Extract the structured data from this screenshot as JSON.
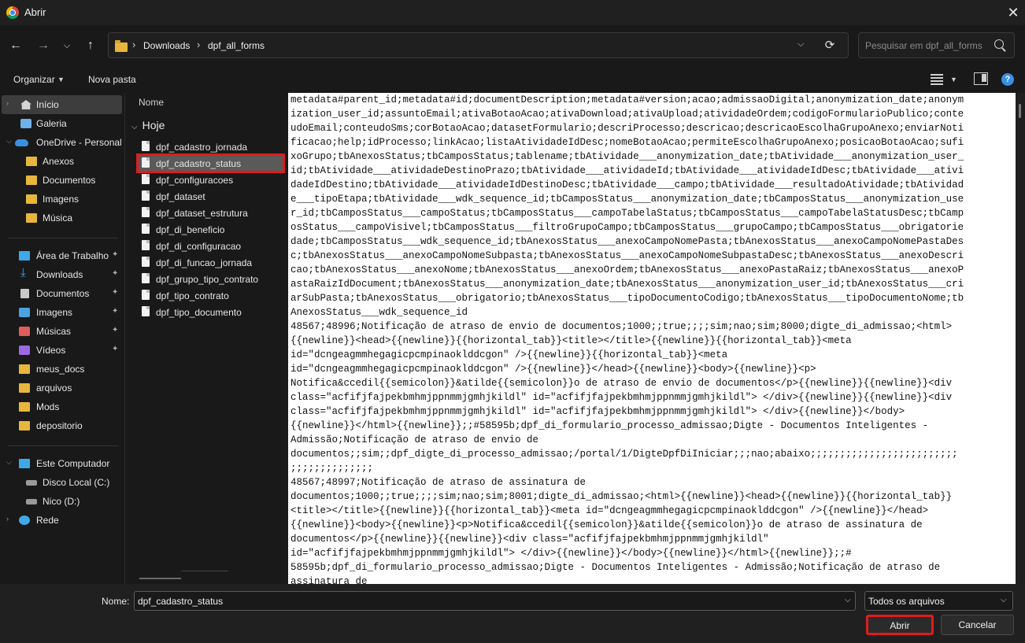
{
  "window": {
    "title": "Abrir"
  },
  "nav": {
    "breadcrumb": [
      "Downloads",
      "dpf_all_forms"
    ],
    "search_placeholder": "Pesquisar em dpf_all_forms"
  },
  "toolbar": {
    "organize": "Organizar",
    "new_folder": "Nova pasta"
  },
  "sidebar": {
    "items": [
      {
        "label": "Início",
        "icon": "home-icon"
      },
      {
        "label": "Galeria",
        "icon": "gallery-icon"
      },
      {
        "label": "OneDrive - Personal",
        "icon": "cloud-icon"
      },
      {
        "label": "Anexos",
        "icon": "folder-icon"
      },
      {
        "label": "Documentos",
        "icon": "folder-icon"
      },
      {
        "label": "Imagens",
        "icon": "folder-icon"
      },
      {
        "label": "Música",
        "icon": "folder-icon"
      },
      {
        "label": "Área de Trabalho",
        "icon": "desktop-icon"
      },
      {
        "label": "Downloads",
        "icon": "download-icon"
      },
      {
        "label": "Documentos",
        "icon": "documents-icon"
      },
      {
        "label": "Imagens",
        "icon": "pictures-icon"
      },
      {
        "label": "Músicas",
        "icon": "music-icon"
      },
      {
        "label": "Vídeos",
        "icon": "videos-icon"
      },
      {
        "label": "meus_docs",
        "icon": "folder-icon"
      },
      {
        "label": "arquivos",
        "icon": "folder-icon"
      },
      {
        "label": "Mods",
        "icon": "folder-icon"
      },
      {
        "label": "depositorio",
        "icon": "folder-icon"
      },
      {
        "label": "Este Computador",
        "icon": "computer-icon"
      },
      {
        "label": "Disco Local (C:)",
        "icon": "drive-icon"
      },
      {
        "label": "Nico (D:)",
        "icon": "drive-icon"
      },
      {
        "label": "Rede",
        "icon": "network-icon"
      }
    ]
  },
  "filelist": {
    "column_header": "Nome",
    "group_label": "Hoje",
    "files": [
      "dpf_cadastro_jornada",
      "dpf_cadastro_status",
      "dpf_configuracoes",
      "dpf_dataset",
      "dpf_dataset_estrutura",
      "dpf_di_beneficio",
      "dpf_di_configuracao",
      "dpf_di_funcao_jornada",
      "dpf_grupo_tipo_contrato",
      "dpf_tipo_contrato",
      "dpf_tipo_documento"
    ],
    "selected_file": "dpf_cadastro_status"
  },
  "preview": {
    "lines": [
      "metadata#parent_id;metadata#id;documentDescription;metadata#version;acao;admissaoDigital;anonymization_date;anonym",
      "ization_user_id;assuntoEmail;ativaBotaoAcao;ativaDownload;ativaUpload;atividadeOrdem;codigoFormularioPublico;conte",
      "udoEmail;conteudoSms;corBotaoAcao;datasetFormulario;descriProcesso;descricao;descricaoEscolhaGrupoAnexo;enviarNoti",
      "ficacao;help;idProcesso;linkAcao;listaAtividadeIdDesc;nomeBotaoAcao;permiteEscolhaGrupoAnexo;posicaoBotaoAcao;sufi",
      "xoGrupo;tbAnexosStatus;tbCamposStatus;tablename;tbAtividade___anonymization_date;tbAtividade___anonymization_user_",
      "id;tbAtividade___atividadeDestinoPrazo;tbAtividade___atividadeId;tbAtividade___atividadeIdDesc;tbAtividade___ativi",
      "dadeIdDestino;tbAtividade___atividadeIdDestinoDesc;tbAtividade___campo;tbAtividade___resultadoAtividade;tbAtividad",
      "e___tipoEtapa;tbAtividade___wdk_sequence_id;tbCamposStatus___anonymization_date;tbCamposStatus___anonymization_use",
      "r_id;tbCamposStatus___campoStatus;tbCamposStatus___campoTabelaStatus;tbCamposStatus___campoTabelaStatusDesc;tbCamp",
      "osStatus___campoVisivel;tbCamposStatus___filtroGrupoCampo;tbCamposStatus___grupoCampo;tbCamposStatus___obrigatorie",
      "dade;tbCamposStatus___wdk_sequence_id;tbAnexosStatus___anexoCampoNomePasta;tbAnexosStatus___anexoCampoNomePastaDes",
      "c;tbAnexosStatus___anexoCampoNomeSubpasta;tbAnexosStatus___anexoCampoNomeSubpastaDesc;tbAnexosStatus___anexoDescri",
      "cao;tbAnexosStatus___anexoNome;tbAnexosStatus___anexoOrdem;tbAnexosStatus___anexoPastaRaiz;tbAnexosStatus___anexoP",
      "astaRaizIdDocument;tbAnexosStatus___anonymization_date;tbAnexosStatus___anonymization_user_id;tbAnexosStatus___cri",
      "arSubPasta;tbAnexosStatus___obrigatorio;tbAnexosStatus___tipoDocumentoCodigo;tbAnexosStatus___tipoDocumentoNome;tb",
      "AnexosStatus___wdk_sequence_id",
      "48567;48996;Notificação de atraso de envio de documentos;1000;;true;;;;sim;nao;sim;8000;digte_di_admissao;<html>",
      "{{newline}}<head>{{newline}}{{horizontal_tab}}<title></title>{{newline}}{{horizontal_tab}}<meta",
      "id=\"dcngeagmmhegagicpcmpinaoklddcgon\" />{{newline}}{{horizontal_tab}}<meta",
      "id=\"dcngeagmmhegagicpcmpinaoklddcgon\" />{{newline}}</head>{{newline}}<body>{{newline}}<p>",
      "Notifica&ccedil{{semicolon}}&atilde{{semicolon}}o de atraso de envio de documentos</p>{{newline}}{{newline}}<div",
      "class=\"acfifjfajpekbmhmjppnmmjgmhjkildl\" id=\"acfifjfajpekbmhmjppnmmjgmhjkildl\"> </div>{{newline}}{{newline}}<div",
      "class=\"acfifjfajpekbmhmjppnmmjgmhjkildl\" id=\"acfifjfajpekbmhmjppnmmjgmhjkildl\"> </div>{{newline}}</body>",
      "{{newline}}</html>{{newline}};;#58595b;dpf_di_formulario_processo_admissao;Digte - Documentos Inteligentes -",
      "Admissão;Notificação de atraso de envio de",
      "documentos;;sim;;dpf_digte_di_processo_admissao;/portal/1/DigteDpfDiIniciar;;;nao;abaixo;;;;;;;;;;;;;;;;;;;;;;;;;",
      ";;;;;;;;;;;;;;",
      "48567;48997;Notificação de atraso de assinatura de",
      "documentos;1000;;true;;;;sim;nao;sim;8001;digte_di_admissao;<html>{{newline}}<head>{{newline}}{{horizontal_tab}}",
      "<title></title>{{newline}}{{horizontal_tab}}<meta id=\"dcngeagmmhegagicpcmpinaoklddcgon\" />{{newline}}</head>",
      "{{newline}}<body>{{newline}}<p>Notifica&ccedil{{semicolon}}&atilde{{semicolon}}o de atraso de assinatura de",
      "documentos</p>{{newline}}{{newline}}<div class=\"acfifjfajpekbmhmjppnmmjgmhjkildl\"",
      "id=\"acfifjfajpekbmhmjppnmmjgmhjkildl\"> </div>{{newline}}</body>{{newline}}</html>{{newline}};;#",
      "58595b;dpf_di_formulario_processo_admissao;Digte - Documentos Inteligentes - Admissão;Notificação de atraso de",
      "assinatura de"
    ]
  },
  "footer": {
    "name_label": "Nome:",
    "name_value": "dpf_cadastro_status",
    "file_type": "Todos os arquivos",
    "open_label": "Abrir",
    "cancel_label": "Cancelar"
  }
}
